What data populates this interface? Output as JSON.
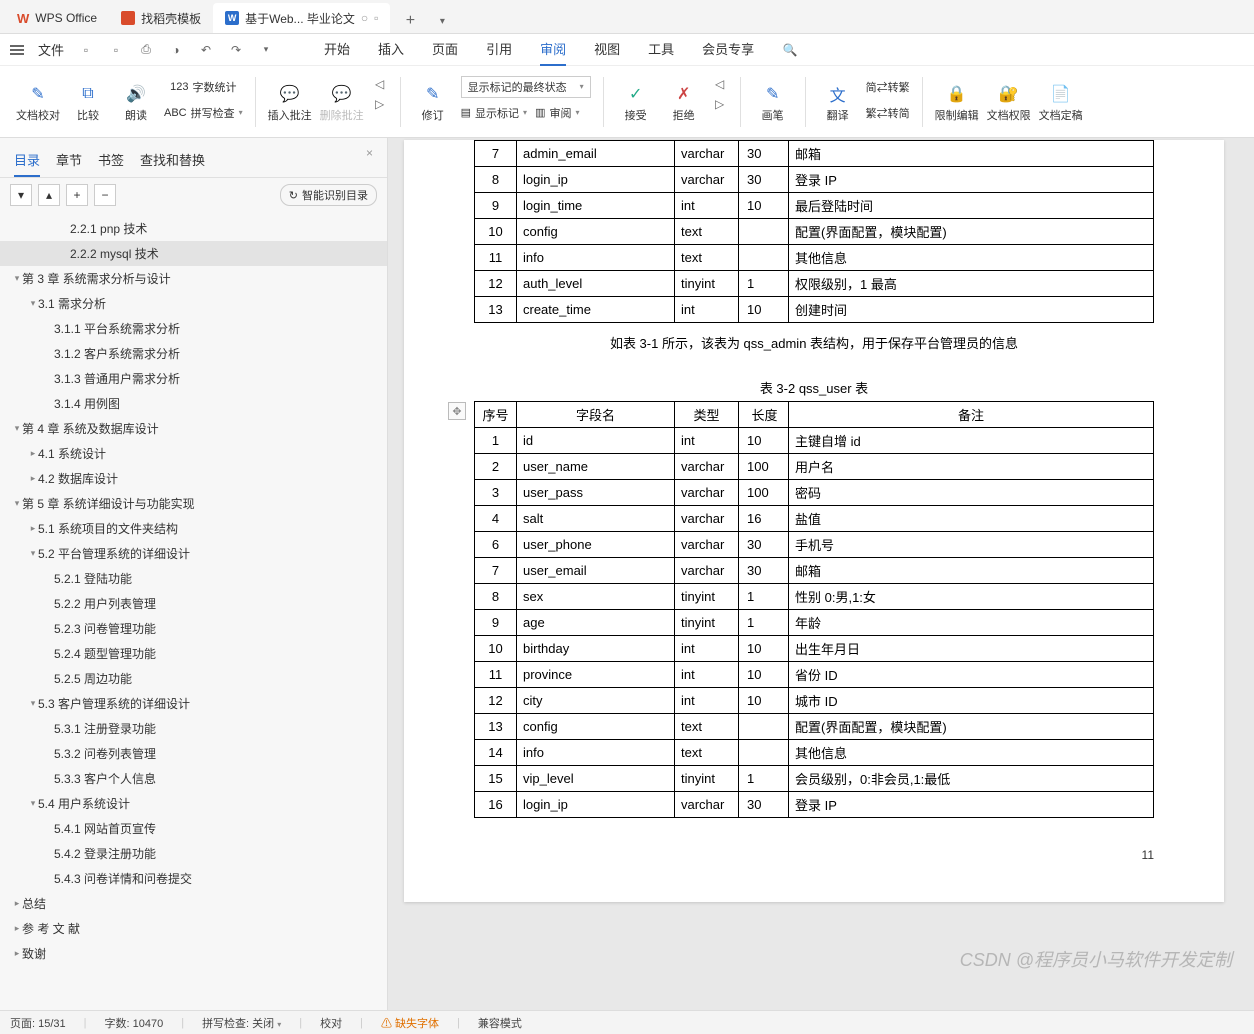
{
  "apptabs": {
    "office": "WPS Office",
    "templates": "找稻壳模板",
    "doc": "基于Web... 毕业论文"
  },
  "quick": {
    "file": "文件"
  },
  "ribbon_tabs": [
    "开始",
    "插入",
    "页面",
    "引用",
    "审阅",
    "视图",
    "工具",
    "会员专享"
  ],
  "ribbon_active_index": 4,
  "ribbon": {
    "proof": "文档校对",
    "compare": "比较",
    "read": "朗读",
    "spell": "拼写检查",
    "wordcount": "字数统计",
    "insc": "插入批注",
    "delc": "删除批注",
    "rev": "修订",
    "show_state": "显示标记的最终状态",
    "show_marks": "显示标记",
    "review_pane": "审阅",
    "accept": "接受",
    "reject": "拒绝",
    "brush": "画笔",
    "trans": "翻译",
    "s2t": "简⇄转繁",
    "s2t2": "繁⇄转简",
    "restrict": "限制编辑",
    "perm": "文档权限",
    "finalize": "文档定稿",
    "abc": "ABC",
    "cnt": "123"
  },
  "sidebar_tabs": [
    "目录",
    "章节",
    "书签",
    "查找和替换"
  ],
  "smart_toc": "智能识别目录",
  "toc": [
    {
      "t": "2.2.1 pnp 技术",
      "lv": 4
    },
    {
      "t": "2.2.2 mysql 技术",
      "lv": 4,
      "sel": true
    },
    {
      "t": "第 3 章 系统需求分析与设计",
      "lv": 1,
      "e": true
    },
    {
      "t": "3.1 需求分析",
      "lv": 2,
      "e": true
    },
    {
      "t": "3.1.1 平台系统需求分析",
      "lv": 3
    },
    {
      "t": "3.1.2 客户系统需求分析",
      "lv": 3
    },
    {
      "t": "3.1.3 普通用户需求分析",
      "lv": 3
    },
    {
      "t": "3.1.4 用例图",
      "lv": 3
    },
    {
      "t": "第 4 章 系统及数据库设计",
      "lv": 1,
      "e": true
    },
    {
      "t": "4.1 系统设计",
      "lv": 2
    },
    {
      "t": "4.2 数据库设计",
      "lv": 2
    },
    {
      "t": "第 5 章 系统详细设计与功能实现",
      "lv": 1,
      "e": true
    },
    {
      "t": "5.1 系统项目的文件夹结构",
      "lv": 2
    },
    {
      "t": "5.2 平台管理系统的详细设计",
      "lv": 2,
      "e": true
    },
    {
      "t": "5.2.1 登陆功能",
      "lv": 3
    },
    {
      "t": "5.2.2 用户列表管理",
      "lv": 3
    },
    {
      "t": "5.2.3 问卷管理功能",
      "lv": 3
    },
    {
      "t": "5.2.4 题型管理功能",
      "lv": 3
    },
    {
      "t": "5.2.5 周边功能",
      "lv": 3
    },
    {
      "t": "5.3 客户管理系统的详细设计",
      "lv": 2,
      "e": true
    },
    {
      "t": "5.3.1 注册登录功能",
      "lv": 3
    },
    {
      "t": "5.3.2 问卷列表管理",
      "lv": 3
    },
    {
      "t": "5.3.3 客户个人信息",
      "lv": 3
    },
    {
      "t": "5.4 用户系统设计",
      "lv": 2,
      "e": true
    },
    {
      "t": "5.4.1 网站首页宣传",
      "lv": 3
    },
    {
      "t": "5.4.2 登录注册功能",
      "lv": 3
    },
    {
      "t": "5.4.3 问卷详情和问卷提交",
      "lv": 3
    },
    {
      "t": "总结",
      "lv": 1
    },
    {
      "t": "参 考 文 献",
      "lv": 1
    },
    {
      "t": "致谢",
      "lv": 1
    }
  ],
  "doc": {
    "table1_rows": [
      [
        "7",
        "admin_email",
        "varchar",
        "30",
        "邮箱"
      ],
      [
        "8",
        "login_ip",
        "varchar",
        "30",
        "登录 IP"
      ],
      [
        "9",
        "login_time",
        "int",
        "10",
        "最后登陆时间"
      ],
      [
        "10",
        "config",
        "text",
        "",
        "配置(界面配置，模块配置)"
      ],
      [
        "11",
        "info",
        "text",
        "",
        "其他信息"
      ],
      [
        "12",
        "auth_level",
        "tinyint",
        "1",
        "权限级别，1 最高"
      ],
      [
        "13",
        "create_time",
        "int",
        "10",
        "创建时间"
      ]
    ],
    "cap1": "如表 3-1 所示，该表为 qss_admin 表结构，用于保存平台管理员的信息",
    "cap2": "表 3-2  qss_user 表",
    "t2_head": [
      "序号",
      "字段名",
      "类型",
      "长度",
      "备注"
    ],
    "table2_rows": [
      [
        "1",
        "id",
        "int",
        "10",
        "主键自增 id"
      ],
      [
        "2",
        "user_name",
        "varchar",
        "100",
        "用户名"
      ],
      [
        "3",
        "user_pass",
        "varchar",
        "100",
        "密码"
      ],
      [
        "4",
        "salt",
        "varchar",
        "16",
        "盐值"
      ],
      [
        "6",
        "user_phone",
        "varchar",
        "30",
        "手机号"
      ],
      [
        "7",
        "user_email",
        "varchar",
        "30",
        "邮箱"
      ],
      [
        "8",
        "sex",
        "tinyint",
        "1",
        "性别 0:男,1:女"
      ],
      [
        "9",
        "age",
        "tinyint",
        "1",
        "年龄"
      ],
      [
        "10",
        "birthday",
        "int",
        "10",
        "出生年月日"
      ],
      [
        "11",
        "province",
        "int",
        "10",
        "省份 ID"
      ],
      [
        "12",
        "city",
        "int",
        "10",
        "城市 ID"
      ],
      [
        "13",
        "config",
        "text",
        "",
        "配置(界面配置，模块配置)"
      ],
      [
        "14",
        "info",
        "text",
        "",
        "其他信息"
      ],
      [
        "15",
        "vip_level",
        "tinyint",
        "1",
        "会员级别，0:非会员,1:最低"
      ],
      [
        "16",
        "login_ip",
        "varchar",
        "30",
        "登录 IP"
      ]
    ],
    "pgnum": "11"
  },
  "status": {
    "page": "页面: 15/31",
    "words": "字数: 10470",
    "spell": "拼写检查: 关闭",
    "proof": "校对",
    "missing": "缺失字体",
    "compat": "兼容模式"
  },
  "watermark": "CSDN @程序员小马软件开发定制"
}
